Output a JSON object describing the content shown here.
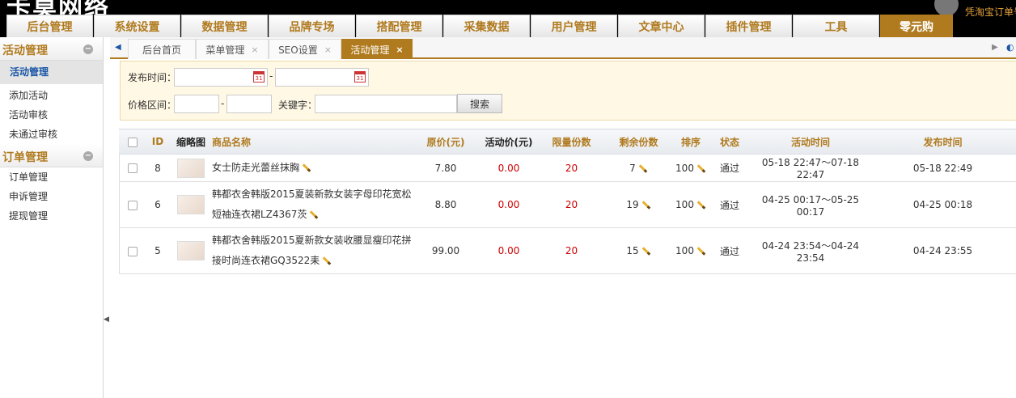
{
  "app": {
    "logo": "卡莫网络",
    "user_text": "凭淘宝订单号"
  },
  "nav": [
    "后台管理",
    "系统设置",
    "数据管理",
    "品牌专场",
    "搭配管理",
    "采集数据",
    "用户管理",
    "文章中心",
    "插件管理",
    "工具",
    "零元购"
  ],
  "sidebar": {
    "sections": [
      {
        "title": "活动管理",
        "toggle": "−",
        "items": [
          "活动管理",
          "添加活动",
          "活动审核",
          "未通过审核"
        ]
      },
      {
        "title": "订单管理",
        "toggle": "−",
        "items": [
          "订单管理",
          "申诉管理",
          "提现管理"
        ]
      }
    ]
  },
  "tabs": [
    {
      "label": "后台首页",
      "closable": false
    },
    {
      "label": "菜单管理",
      "closable": true
    },
    {
      "label": "SEO设置",
      "closable": true
    },
    {
      "label": "活动管理",
      "closable": true
    }
  ],
  "tab_close": "×",
  "search": {
    "publish_time_label": "发布时间：",
    "dash": "-",
    "price_label": "价格区间：",
    "keyword_label": "关键字：",
    "search_button": "搜索",
    "cal_day": "31"
  },
  "table": {
    "headers": [
      "",
      "ID",
      "缩略图",
      "商品名称",
      "原价(元)",
      "活动价(元)",
      "限量份数",
      "剩余份数",
      "排序",
      "状态",
      "活动时间",
      "发布时间"
    ],
    "rows": [
      {
        "id": "8",
        "name": "女士防走光蕾丝抹胸",
        "orig": "7.80",
        "act": "0.00",
        "limit": "20",
        "remain": "7",
        "sort": "100",
        "status": "通过",
        "act_time": "05-18 22:47～07-18 22:47",
        "pub_time": "05-18 22:49"
      },
      {
        "id": "6",
        "name": "韩都衣舍韩版2015夏装新款女装字母印花宽松短袖连衣裙LZ4367茨",
        "orig": "8.80",
        "act": "0.00",
        "limit": "20",
        "remain": "19",
        "sort": "100",
        "status": "通过",
        "act_time": "04-25 00:17～05-25 00:17",
        "pub_time": "04-25 00:18"
      },
      {
        "id": "5",
        "name": "韩都衣舍韩版2015夏新款女装收腰显瘦印花拼接时尚连衣裙GQ3522耒",
        "orig": "99.00",
        "act": "0.00",
        "limit": "20",
        "remain": "15",
        "sort": "100",
        "status": "通过",
        "act_time": "04-24 23:54～04-24 23:54",
        "pub_time": "04-24 23:55"
      }
    ]
  },
  "colors": {
    "accent": "#b07a1e",
    "link": "#1a56a6",
    "price_red": "#cc0000"
  }
}
